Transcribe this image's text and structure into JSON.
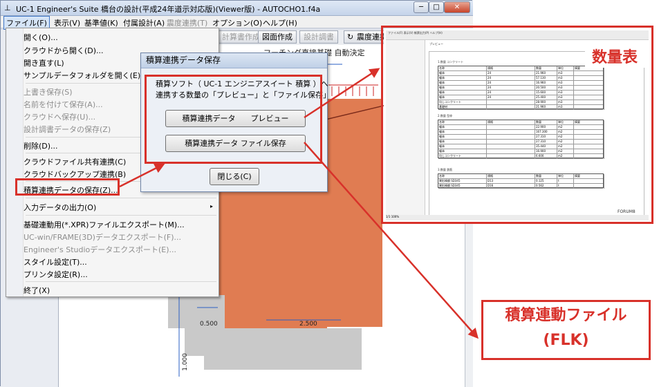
{
  "window": {
    "title": "UC-1 Engineer's Suite 橋台の設計(平成24年道示対応版)(Viewer版) - AUTOCHO1.f4a",
    "min_label": "─",
    "max_label": "□",
    "close_label": "✕"
  },
  "menubar": {
    "items": [
      {
        "label": "ファイル(F)",
        "state": "selected"
      },
      {
        "label": "表示(V)",
        "state": "normal"
      },
      {
        "label": "基準値(K)",
        "state": "normal"
      },
      {
        "label": "付属設計(A)",
        "state": "normal"
      },
      {
        "label": "震度連携(T)",
        "state": "disabled"
      },
      {
        "label": "オプション(O)",
        "state": "normal"
      },
      {
        "label": "ヘルプ(H)",
        "state": "normal"
      }
    ]
  },
  "toolbar": {
    "items": [
      {
        "label": "計算書作成",
        "state": "disabled"
      },
      {
        "label": "図面作成",
        "state": "normal"
      },
      {
        "label": "設計調書",
        "state": "disabled"
      },
      {
        "label": "震度連携",
        "state": "normal"
      }
    ]
  },
  "file_menu": {
    "items": [
      {
        "label": "開く(O)...",
        "state": "normal"
      },
      {
        "label": "クラウドから開く(D)...",
        "state": "normal"
      },
      {
        "label": "開き直す(L)",
        "state": "normal"
      },
      {
        "label": "サンプルデータフォルダを開く(E)",
        "state": "normal"
      },
      {
        "label": "上書き保存(S)",
        "state": "disabled"
      },
      {
        "label": "名前を付けて保存(A)...",
        "state": "disabled"
      },
      {
        "label": "クラウドへ保存(U)...",
        "state": "disabled"
      },
      {
        "label": "設計調書データの保存(Z)",
        "state": "disabled"
      },
      {
        "label": "削除(D)...",
        "state": "normal"
      },
      {
        "label": "クラウドファイル共有連携(C)",
        "state": "normal"
      },
      {
        "label": "クラウドバックアップ連携(B)",
        "state": "normal"
      },
      {
        "label": "積算連携データの保存(Z)...",
        "state": "highlighted"
      },
      {
        "label": "入力データの出力(O)",
        "state": "submenu"
      },
      {
        "label": "基礎連動用(*.XPR)ファイルエクスポート(M)...",
        "state": "normal"
      },
      {
        "label": "UC-win/FRAME(3D)データエクスポート(F)...",
        "state": "disabled"
      },
      {
        "label": "Engineer's Studioデータエクスポート(E)...",
        "state": "disabled"
      },
      {
        "label": "スタイル設定(T)...",
        "state": "normal"
      },
      {
        "label": "プリンタ設定(R)...",
        "state": "normal"
      },
      {
        "label": "終了(X)",
        "state": "normal"
      }
    ],
    "submenu_arrow": "▸"
  },
  "dialog": {
    "title": "積算連携データ保存",
    "line1": "積算ソフト（ UC-1 エンジニアスイート 積算 ）へ",
    "line2": "連携する数量の「プレビュー」と「ファイル保存」",
    "preview_button": "積算連携データ　　プレビュー",
    "save_button": "積算連携データ  ファイル保存",
    "close_button": "閉じる(C)"
  },
  "drawing": {
    "header_text": "フーチング直接基礎 自動決定",
    "dim_left": "0.500",
    "dim_right": "2.500",
    "dim_vertical": "1.000"
  },
  "preview_window": {
    "toolbar_text": "ファイル(F)  表示(V)  帳票出力(P)  ヘルプ(H)",
    "tab_label": "プレビュー",
    "section1": "1.数量  コンクリート",
    "section2": "2.数量  型枠",
    "section3": "3.数量  鉄筋",
    "col_headers": [
      "名称",
      "規格",
      "数量",
      "単位",
      "摘要"
    ],
    "rows1": [
      [
        "躯体",
        "24",
        "21.960",
        "m3"
      ],
      [
        "躯体",
        "24",
        "57.130",
        "m3"
      ],
      [
        "躯体",
        "24",
        "16.960",
        "m3"
      ],
      [
        "躯体",
        "24",
        "20.500",
        "m3"
      ],
      [
        "躯体",
        "24",
        "15.600",
        "m3"
      ],
      [
        "躯体",
        "24",
        "25.400",
        "m3"
      ],
      [
        "均しコンクリート",
        "",
        "28.900",
        "m3"
      ],
      [
        "基礎材",
        "",
        "21.960",
        "m3"
      ]
    ],
    "rows2": [
      [
        "躯体",
        "",
        "22.900",
        "m2"
      ],
      [
        "躯体",
        "",
        "167.300",
        "m2"
      ],
      [
        "躯体",
        "",
        "27.310",
        "m2"
      ],
      [
        "躯体",
        "",
        "27.310",
        "m2"
      ],
      [
        "躯体",
        "",
        "35.440",
        "m2"
      ],
      [
        "躯体",
        "",
        "16.900",
        "m2"
      ],
      [
        "均しコンクリート",
        "",
        "6.600",
        "m2"
      ]
    ],
    "rows3": [
      [
        "異形棒鋼 SD345",
        "D13",
        "0.125",
        "t"
      ],
      [
        "異形棒鋼 SD345",
        "D16",
        "0.562",
        "t"
      ]
    ],
    "footer_logo": "FORUM8",
    "status_text": "1/1  100%"
  },
  "callouts": {
    "quantity_table": "数量表",
    "flk_file_line1": "積算連動ファイル",
    "flk_file_line2": "(FLK)"
  },
  "colors": {
    "annotation_red": "#d8312a",
    "abutment_orange": "#e07c52"
  }
}
